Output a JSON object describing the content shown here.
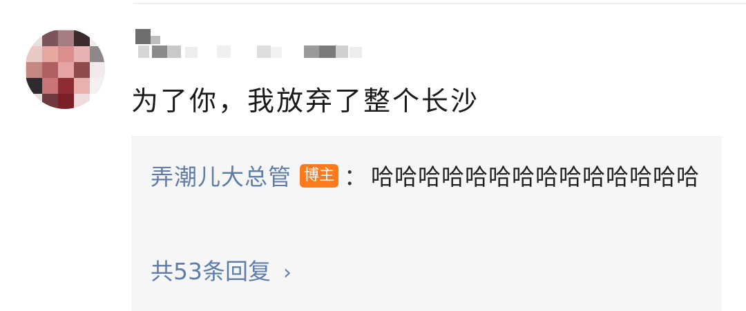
{
  "comment": {
    "text": "为了你，我放弃了整个长沙"
  },
  "reply": {
    "author": "弄潮儿大总管",
    "badge": "博主",
    "separator": "：",
    "content": "哈哈哈哈哈哈哈哈哈哈哈哈哈哈"
  },
  "more_replies": {
    "label": "共53条回复",
    "chevron": "›"
  },
  "colors": {
    "link": "#5e7da8",
    "badge": "#ff7a1a",
    "reply_bg": "#f6f6f7"
  },
  "icons": {
    "chevron": "chevron-right-icon"
  }
}
